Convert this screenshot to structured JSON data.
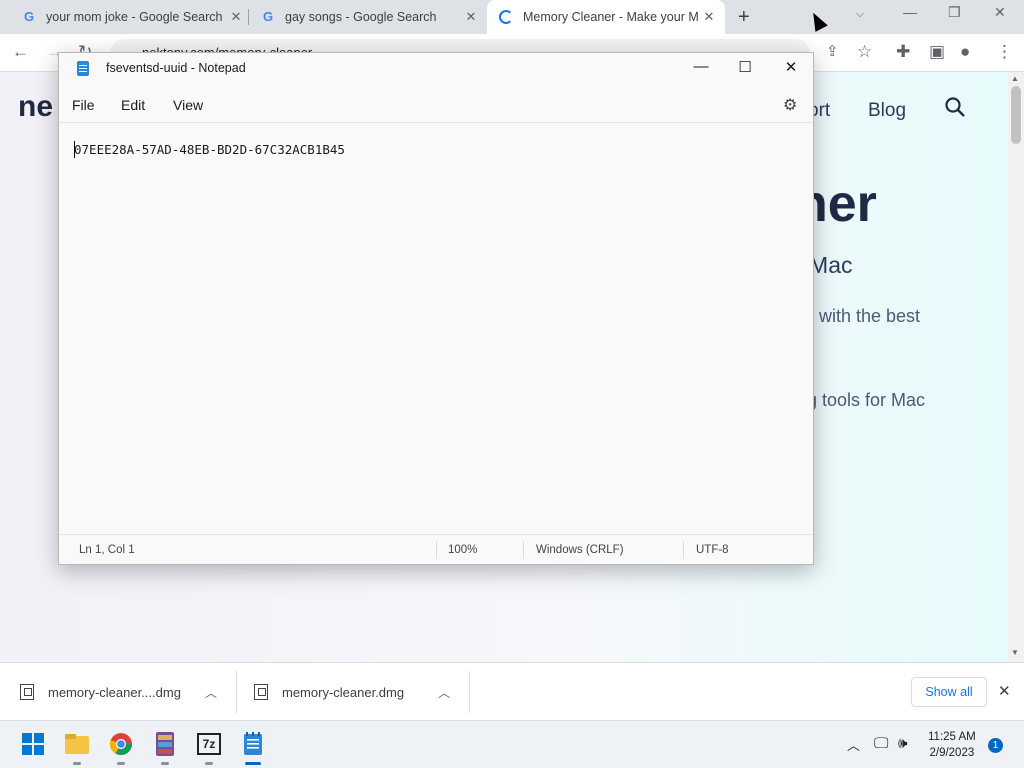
{
  "browser": {
    "tabs": [
      {
        "title": "your mom joke - Google Search",
        "favicon": "google-icon"
      },
      {
        "title": "gay songs - Google Search",
        "favicon": "google-icon"
      },
      {
        "title": "Memory Cleaner - Make your Ma",
        "favicon": "loading-spinner-icon"
      }
    ],
    "url": "nektony.com/memory-cleaner"
  },
  "webpage": {
    "logo": "ne",
    "nav": [
      "ort",
      "Blog"
    ],
    "hero_title": "ner",
    "hero_subtitle": "r Mac",
    "hero_line1": "l with the best",
    "hero_line2": "ng tools for Mac"
  },
  "notepad": {
    "title": "fseventsd-uuid - Notepad",
    "menu": [
      "File",
      "Edit",
      "View"
    ],
    "content": "07EEE28A-57AD-48EB-BD2D-67C32ACB1B45",
    "status": {
      "position": "Ln 1, Col 1",
      "zoom": "100%",
      "line_ending": "Windows (CRLF)",
      "encoding": "UTF-8"
    }
  },
  "downloads": {
    "items": [
      "memory-cleaner....dmg",
      "memory-cleaner.dmg"
    ],
    "show_all": "Show all"
  },
  "taskbar": {
    "time": "11:25 AM",
    "date": "2/9/2023",
    "notifications": "1",
    "apps": [
      "start-icon",
      "file-explorer-icon",
      "chrome-icon",
      "winrar-icon",
      "7zip-icon",
      "notepad-icon"
    ],
    "sevenzip_label": "7z"
  },
  "colors": {
    "accent": "#1a73e8",
    "taskbar_accent": "#0067c0",
    "hero_text": "#1f2a44"
  }
}
